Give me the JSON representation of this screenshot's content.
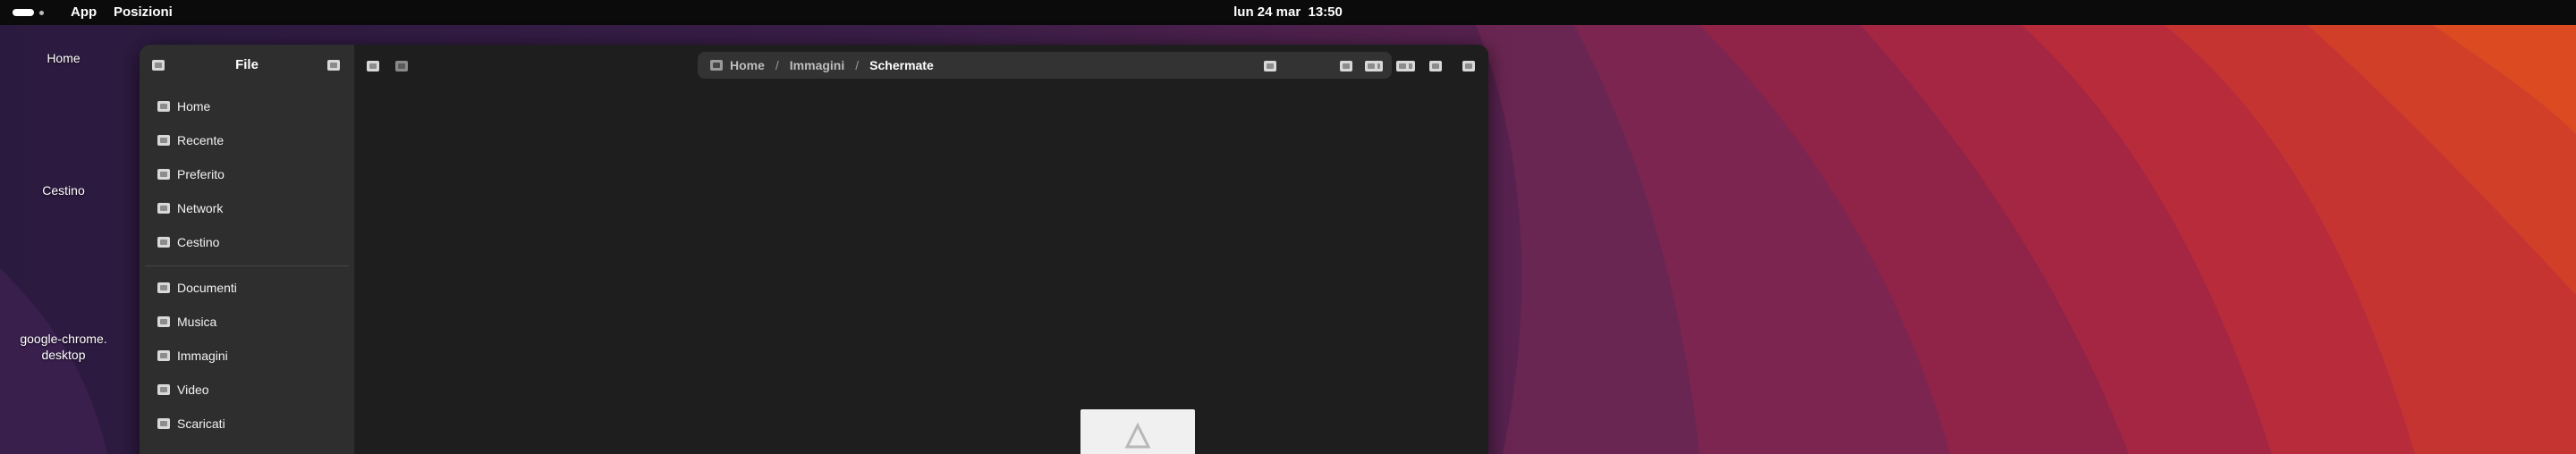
{
  "topbar": {
    "apps": "App",
    "places": "Posizioni",
    "clock": "lun 24 mar  13:50"
  },
  "desktop": {
    "icons": [
      {
        "label": "Home"
      },
      {
        "label": "Cestino"
      },
      {
        "label": "google-chrome.\ndesktop"
      }
    ]
  },
  "window": {
    "sidebar": {
      "title": "File",
      "places": [
        {
          "label": "Home",
          "icon": "home-icon"
        },
        {
          "label": "Recente",
          "icon": "clock-icon"
        },
        {
          "label": "Preferito",
          "icon": "star-icon"
        },
        {
          "label": "Network",
          "icon": "network-icon"
        },
        {
          "label": "Cestino",
          "icon": "trash-icon"
        }
      ],
      "bookmarks": [
        {
          "label": "Documenti",
          "icon": "folder-documents-icon"
        },
        {
          "label": "Musica",
          "icon": "folder-music-icon"
        },
        {
          "label": "Immagini",
          "icon": "folder-pictures-icon"
        },
        {
          "label": "Video",
          "icon": "folder-videos-icon"
        },
        {
          "label": "Scaricati",
          "icon": "folder-download-icon"
        }
      ]
    },
    "pathbar": {
      "crumbs": [
        "Home",
        "Immagini",
        "Schermate"
      ]
    }
  },
  "colors": {
    "topbar": "#0b0b0b",
    "sidebar": "#2e2e2e",
    "content": "#1e1e1e",
    "pathbar": "#333333"
  }
}
